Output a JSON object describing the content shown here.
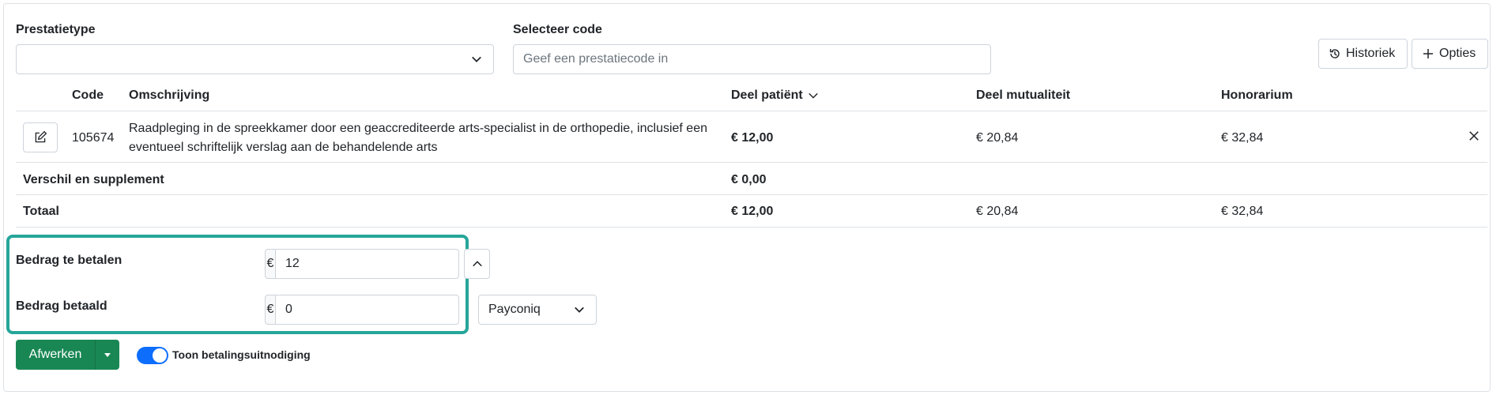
{
  "form": {
    "prestatietype_label": "Prestatietype",
    "prestatietype_value": "",
    "code_label": "Selecteer code",
    "code_placeholder": "Geef een prestatiecode in",
    "code_value": ""
  },
  "actions": {
    "history_label": "Historiek",
    "options_label": "Opties"
  },
  "table": {
    "headers": {
      "code": "Code",
      "description": "Omschrijving",
      "patient_share": "Deel patiënt",
      "mutuality_share": "Deel mutualiteit",
      "fee": "Honorarium"
    },
    "rows": [
      {
        "code": "105674",
        "description": "Raadpleging in de spreekkamer door een geaccrediteerde arts-specialist in de orthopedie, inclusief een eventueel schriftelijk verslag aan de behandelende arts",
        "patient_share": "€ 12,00",
        "mutuality_share": "€ 20,84",
        "fee": "€ 32,84"
      }
    ],
    "supplement": {
      "label": "Verschil en supplement",
      "patient_share": "€ 0,00"
    },
    "total": {
      "label": "Totaal",
      "patient_share": "€ 12,00",
      "mutuality_share": "€ 20,84",
      "fee": "€ 32,84"
    }
  },
  "payment": {
    "currency_symbol": "€",
    "to_pay_label": "Bedrag te betalen",
    "to_pay_value": "12",
    "paid_label": "Bedrag betaald",
    "paid_value": "0",
    "method": "Payconiq"
  },
  "footer": {
    "finish_label": "Afwerken",
    "toggle_label": "Toon betalingsuitnodiging",
    "toggle_on": true
  },
  "colors": {
    "highlight": "#26a69a",
    "primary": "#0d6efd",
    "success": "#198754"
  }
}
